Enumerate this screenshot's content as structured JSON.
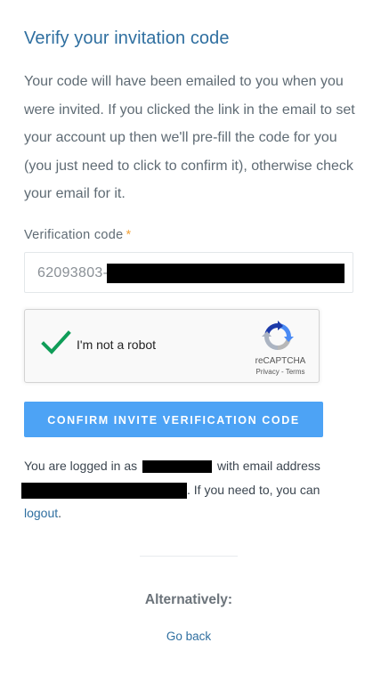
{
  "page": {
    "title": "Verify your invitation code",
    "intro": "Your code will have been emailed to you when you were invited. If you clicked the link in the email to set your account up then we'll pre-fill the code for you (you just need to click to confirm it), otherwise check your email for it."
  },
  "form": {
    "code_label": "Verification code",
    "required_marker": "*",
    "code_value_visible": "62093803-",
    "confirm_label": "CONFIRM INVITE VERIFICATION CODE"
  },
  "recaptcha": {
    "label": "I'm not a robot",
    "brand": "reCAPTCHA",
    "terms": "Privacy - Terms",
    "checked": true
  },
  "account": {
    "prefix": "You are logged in as",
    "email_intro": "with email address",
    "suffix": ". If you need to, you can",
    "logout_label": "logout",
    "logout_tail": "."
  },
  "alternatives": {
    "heading": "Alternatively:",
    "go_back_label": "Go back"
  },
  "colors": {
    "title": "#2f6fa0",
    "button": "#4da3f5",
    "required": "#f2a33a",
    "check": "#0f9d58"
  },
  "icons": {
    "check": "checkmark-icon",
    "recaptcha": "recaptcha-logo-icon"
  }
}
